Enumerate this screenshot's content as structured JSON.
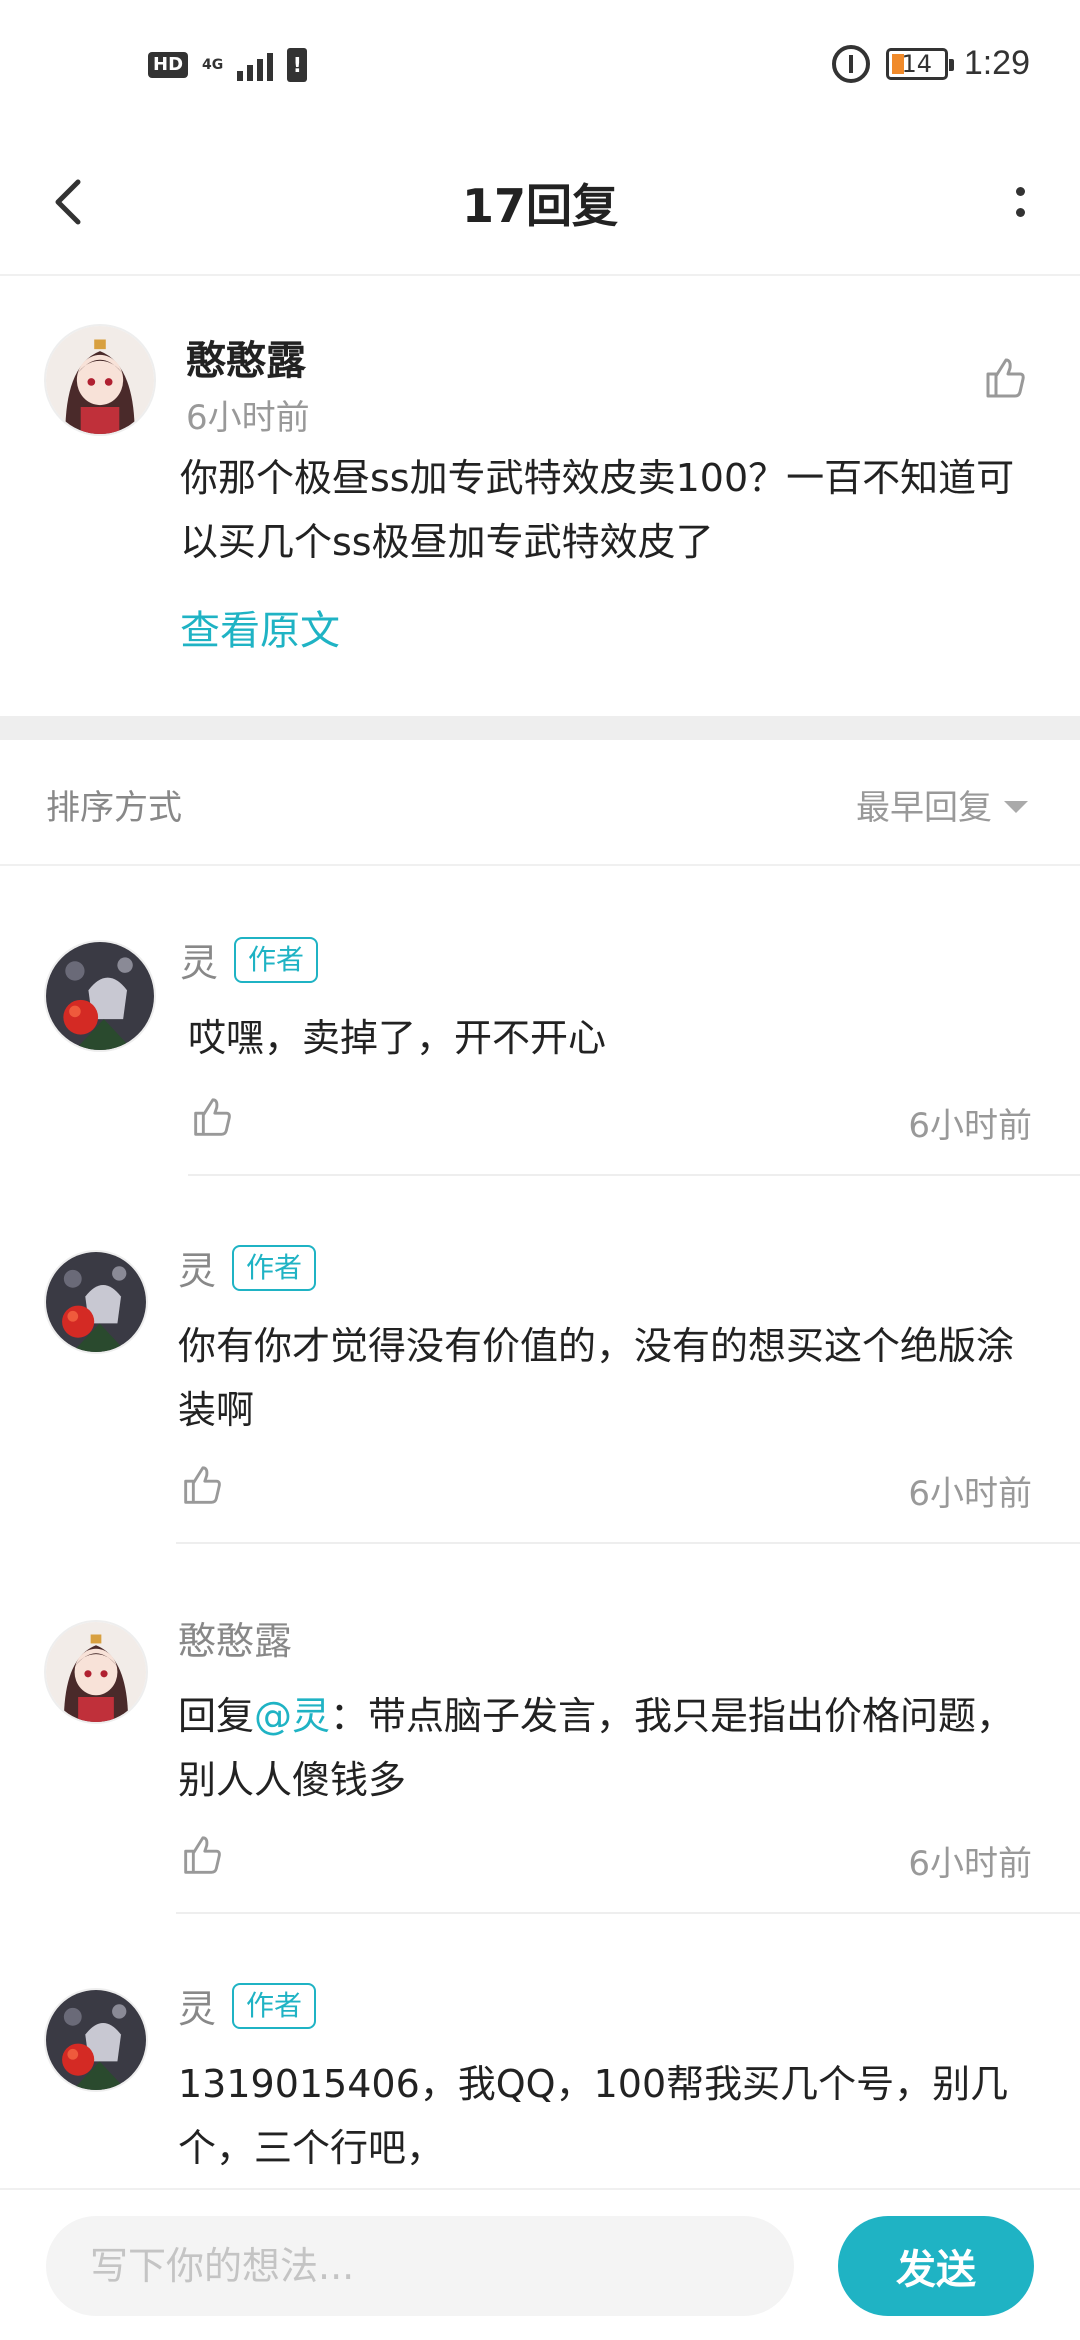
{
  "status_bar": {
    "hd": "HD",
    "network": "4G",
    "battery_level": "14",
    "time": "1:29"
  },
  "header": {
    "title": "17回复"
  },
  "original": {
    "author": "憨憨露",
    "time": "6小时前",
    "text": "你那个极昼ss加专武特效皮卖100？一百不知道可以买几个ss极昼加专武特效皮了",
    "view_original": "查看原文"
  },
  "sort": {
    "label": "排序方式",
    "value": "最早回复"
  },
  "replies": [
    {
      "name": "灵",
      "tag": "作者",
      "text": "哎嘿，卖掉了，开不开心",
      "time": "6小时前"
    },
    {
      "name": "灵",
      "tag": "作者",
      "text": "你有你才觉得没有价值的，没有的想买这个绝版涂装啊",
      "time": "6小时前"
    },
    {
      "name": "憨憨露",
      "reply_prefix": "回复",
      "mention": "@灵",
      "text": "：带点脑子发言，我只是指出价格问题，别人人傻钱多",
      "time": "6小时前"
    },
    {
      "name": "灵",
      "tag": "作者",
      "text": "1319015406，我QQ，100帮我买几个号，别几个，三个行吧，"
    }
  ],
  "bottom_bar": {
    "placeholder": "写下你的想法...",
    "send_label": "发送"
  },
  "colors": {
    "accent": "#1fb3c4",
    "muted_text": "#999999",
    "divider": "#eeeeee"
  }
}
